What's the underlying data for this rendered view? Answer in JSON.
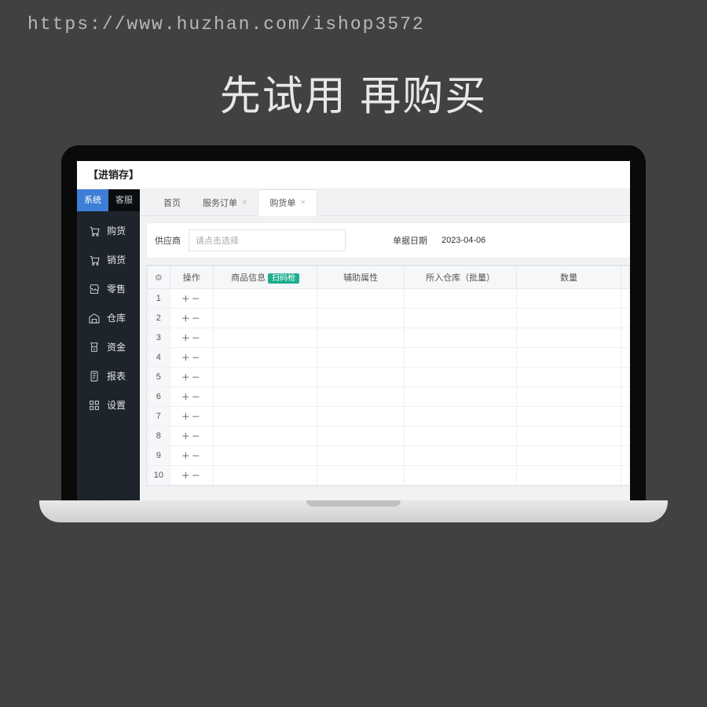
{
  "url": "https://www.huzhan.com/ishop3572",
  "heading": "先试用 再购买",
  "app_title": "【进销存】",
  "sidebar": {
    "tabs": [
      {
        "label": "系统",
        "active": true
      },
      {
        "label": "客服",
        "active": false
      }
    ],
    "menu": [
      {
        "label": "购货",
        "icon": "cart"
      },
      {
        "label": "销货",
        "icon": "cart"
      },
      {
        "label": "零售",
        "icon": "shop"
      },
      {
        "label": "仓库",
        "icon": "warehouse"
      },
      {
        "label": "资金",
        "icon": "money"
      },
      {
        "label": "报表",
        "icon": "report"
      },
      {
        "label": "设置",
        "icon": "grid"
      }
    ]
  },
  "tabs": [
    {
      "label": "首页",
      "closable": false,
      "active": false
    },
    {
      "label": "服务订单",
      "closable": true,
      "active": false
    },
    {
      "label": "购货单",
      "closable": true,
      "active": true
    }
  ],
  "filter": {
    "supplier_label": "供应商",
    "supplier_placeholder": "请点击选择",
    "date_label": "单据日期",
    "date_value": "2023-04-06"
  },
  "table": {
    "columns": {
      "operate": "操作",
      "product_info": "商品信息",
      "scan_badge": "扫码枪",
      "aux_attr": "辅助属性",
      "warehouse": "所入仓库（批量）",
      "quantity": "数量"
    },
    "row_count": 10,
    "op_symbol": "＋－"
  }
}
